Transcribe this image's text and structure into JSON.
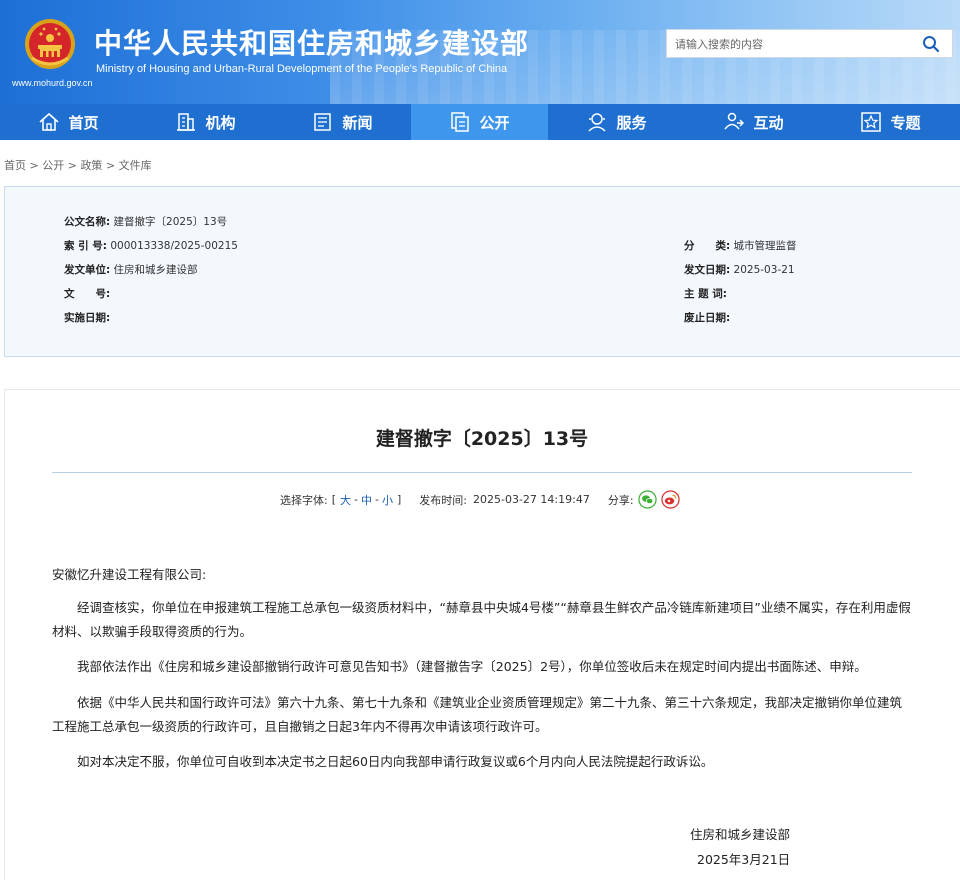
{
  "header": {
    "title_cn": "中华人民共和国住房和城乡建设部",
    "title_en": "Ministry of Housing and Urban-Rural Development of the People's Republic of China",
    "site_url": "www.mohurd.gov.cn",
    "search_placeholder": "请输入搜索的内容",
    "search_icon": "search-icon",
    "colors": {
      "header_start": "#1d6fd6",
      "nav_bg": "#1e6fd0",
      "nav_active": "#3e97ec"
    }
  },
  "nav": {
    "items": [
      {
        "label": "首页",
        "icon": "home-icon"
      },
      {
        "label": "机构",
        "icon": "building-icon"
      },
      {
        "label": "新闻",
        "icon": "news-icon"
      },
      {
        "label": "公开",
        "icon": "documents-icon",
        "active": true
      },
      {
        "label": "服务",
        "icon": "service-icon"
      },
      {
        "label": "互动",
        "icon": "interaction-icon"
      },
      {
        "label": "专题",
        "icon": "topic-star-icon"
      }
    ]
  },
  "breadcrumb": {
    "items": [
      "首页",
      "公开",
      "政策",
      "文件库"
    ],
    "separator": ">"
  },
  "meta": {
    "doc_name": {
      "label": "公文名称:",
      "value": "建督撤字〔2025〕13号"
    },
    "index_no": {
      "label": "索 引 号:",
      "value": "000013338/2025-00215"
    },
    "issuer": {
      "label": "发文单位:",
      "value": "住房和城乡建设部"
    },
    "doc_no": {
      "label": "文　　号:",
      "value": ""
    },
    "effective_date": {
      "label": "实施日期:",
      "value": ""
    },
    "category": {
      "label": "分　　类:",
      "value": "城市管理监督"
    },
    "issue_date": {
      "label": "发文日期:",
      "value": "2025-03-21"
    },
    "keywords": {
      "label": "主 题 词:",
      "value": ""
    },
    "abolish_date": {
      "label": "废止日期:",
      "value": ""
    }
  },
  "article": {
    "title": "建督撤字〔2025〕13号",
    "font_label": "选择字体:",
    "font_open": "[",
    "font_large": "大",
    "font_medium": "中",
    "font_small": "小",
    "font_dash": "-",
    "font_close": "]",
    "publish_label": "发布时间:",
    "publish_time": "2025-03-27 14:19:47",
    "share_label": "分享:",
    "share_icons": [
      "wechat-icon",
      "weibo-icon"
    ],
    "salutation": "安徽忆升建设工程有限公司:",
    "paragraphs": [
      "经调查核实，你单位在申报建筑工程施工总承包一级资质材料中，“赫章县中央城4号楼”“赫章县生鲜农产品冷链库新建项目”业绩不属实，存在利用虚假材料、以欺骗手段取得资质的行为。",
      "我部依法作出《住房和城乡建设部撤销行政许可意见告知书》（建督撤告字〔2025〕2号），你单位签收后未在规定时间内提出书面陈述、申辩。",
      "依据《中华人民共和国行政许可法》第六十九条、第七十九条和《建筑业企业资质管理规定》第二十九条、第三十六条规定，我部决定撤销你单位建筑工程施工总承包一级资质的行政许可，且自撤销之日起3年内不得再次申请该项行政许可。",
      "如对本决定不服，你单位可自收到本决定书之日起60日内向我部申请行政复议或6个月内向人民法院提起行政诉讼。"
    ],
    "signature": "住房和城乡建设部",
    "signature_date": "2025年3月21日"
  }
}
